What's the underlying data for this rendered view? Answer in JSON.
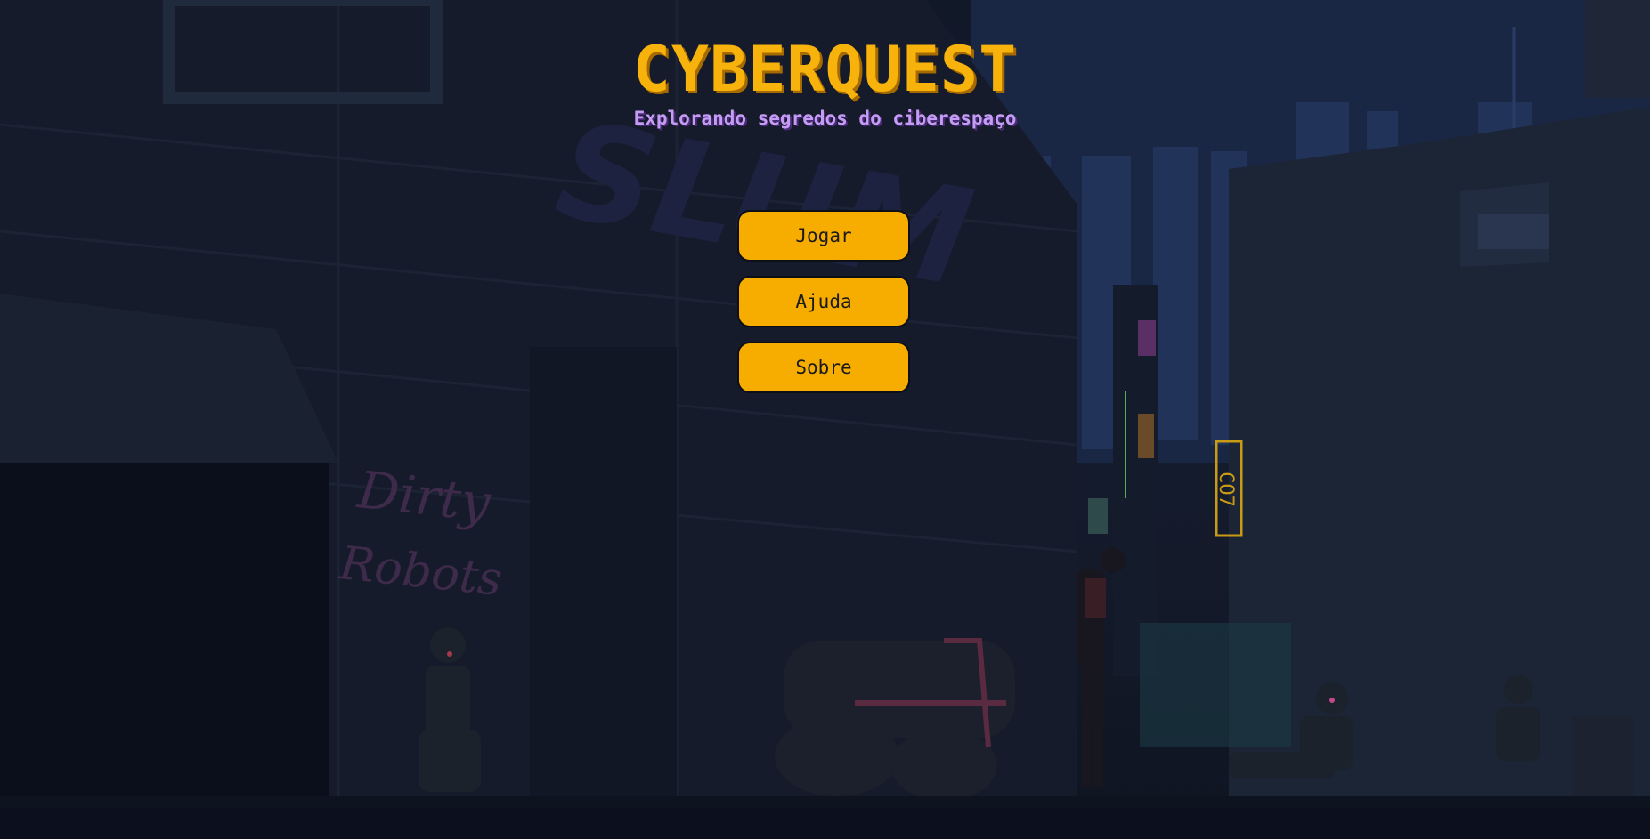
{
  "game": {
    "title": "CYBERQUEST",
    "subtitle": "Explorando segredos do ciberespaço"
  },
  "menu": {
    "items": [
      {
        "label": "Jogar"
      },
      {
        "label": "Ajuda"
      },
      {
        "label": "Sobre"
      }
    ]
  },
  "background": {
    "graffiti": [
      "Dirty",
      "Robots"
    ],
    "neon_sign": "CO7"
  },
  "colors": {
    "accent": "#f7ad00",
    "title": "#f7b20c",
    "subtitle": "#c49cf4",
    "background": "#111828"
  }
}
